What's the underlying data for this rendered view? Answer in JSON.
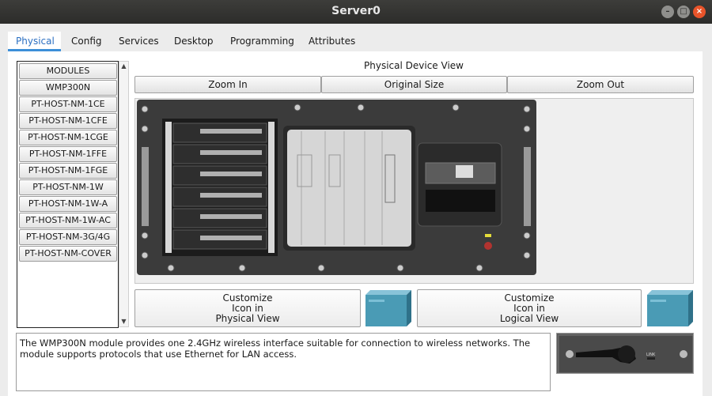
{
  "window": {
    "title": "Server0",
    "minimize_glyph": "–",
    "maximize_glyph": "□",
    "close_glyph": "×"
  },
  "tabs": [
    {
      "label": "Physical",
      "active": true
    },
    {
      "label": "Config"
    },
    {
      "label": "Services"
    },
    {
      "label": "Desktop"
    },
    {
      "label": "Programming"
    },
    {
      "label": "Attributes"
    }
  ],
  "modules": {
    "items": [
      "MODULES",
      "WMP300N",
      "PT-HOST-NM-1CE",
      "PT-HOST-NM-1CFE",
      "PT-HOST-NM-1CGE",
      "PT-HOST-NM-1FFE",
      "PT-HOST-NM-1FGE",
      "PT-HOST-NM-1W",
      "PT-HOST-NM-1W-A",
      "PT-HOST-NM-1W-AC",
      "PT-HOST-NM-3G/4G",
      "PT-HOST-NM-COVER"
    ]
  },
  "physical_view": {
    "label": "Physical Device View",
    "zoom_in": "Zoom In",
    "original_size": "Original Size",
    "zoom_out": "Zoom Out"
  },
  "customize": {
    "physical": {
      "line1": "Customize",
      "line2": "Icon in",
      "line3": "Physical View"
    },
    "logical": {
      "line1": "Customize",
      "line2": "Icon in",
      "line3": "Logical View"
    }
  },
  "description": "The WMP300N module provides one 2.4GHz wireless interface suitable for connection to wireless networks. The module supports protocols that use Ethernet for LAN access.",
  "module_thumb": {
    "port_label": "LINK"
  },
  "colors": {
    "accent": "#3c8fd8",
    "titlebar": "#2c2c2a",
    "close": "#e9542a",
    "cube": "#4a9bb5"
  }
}
